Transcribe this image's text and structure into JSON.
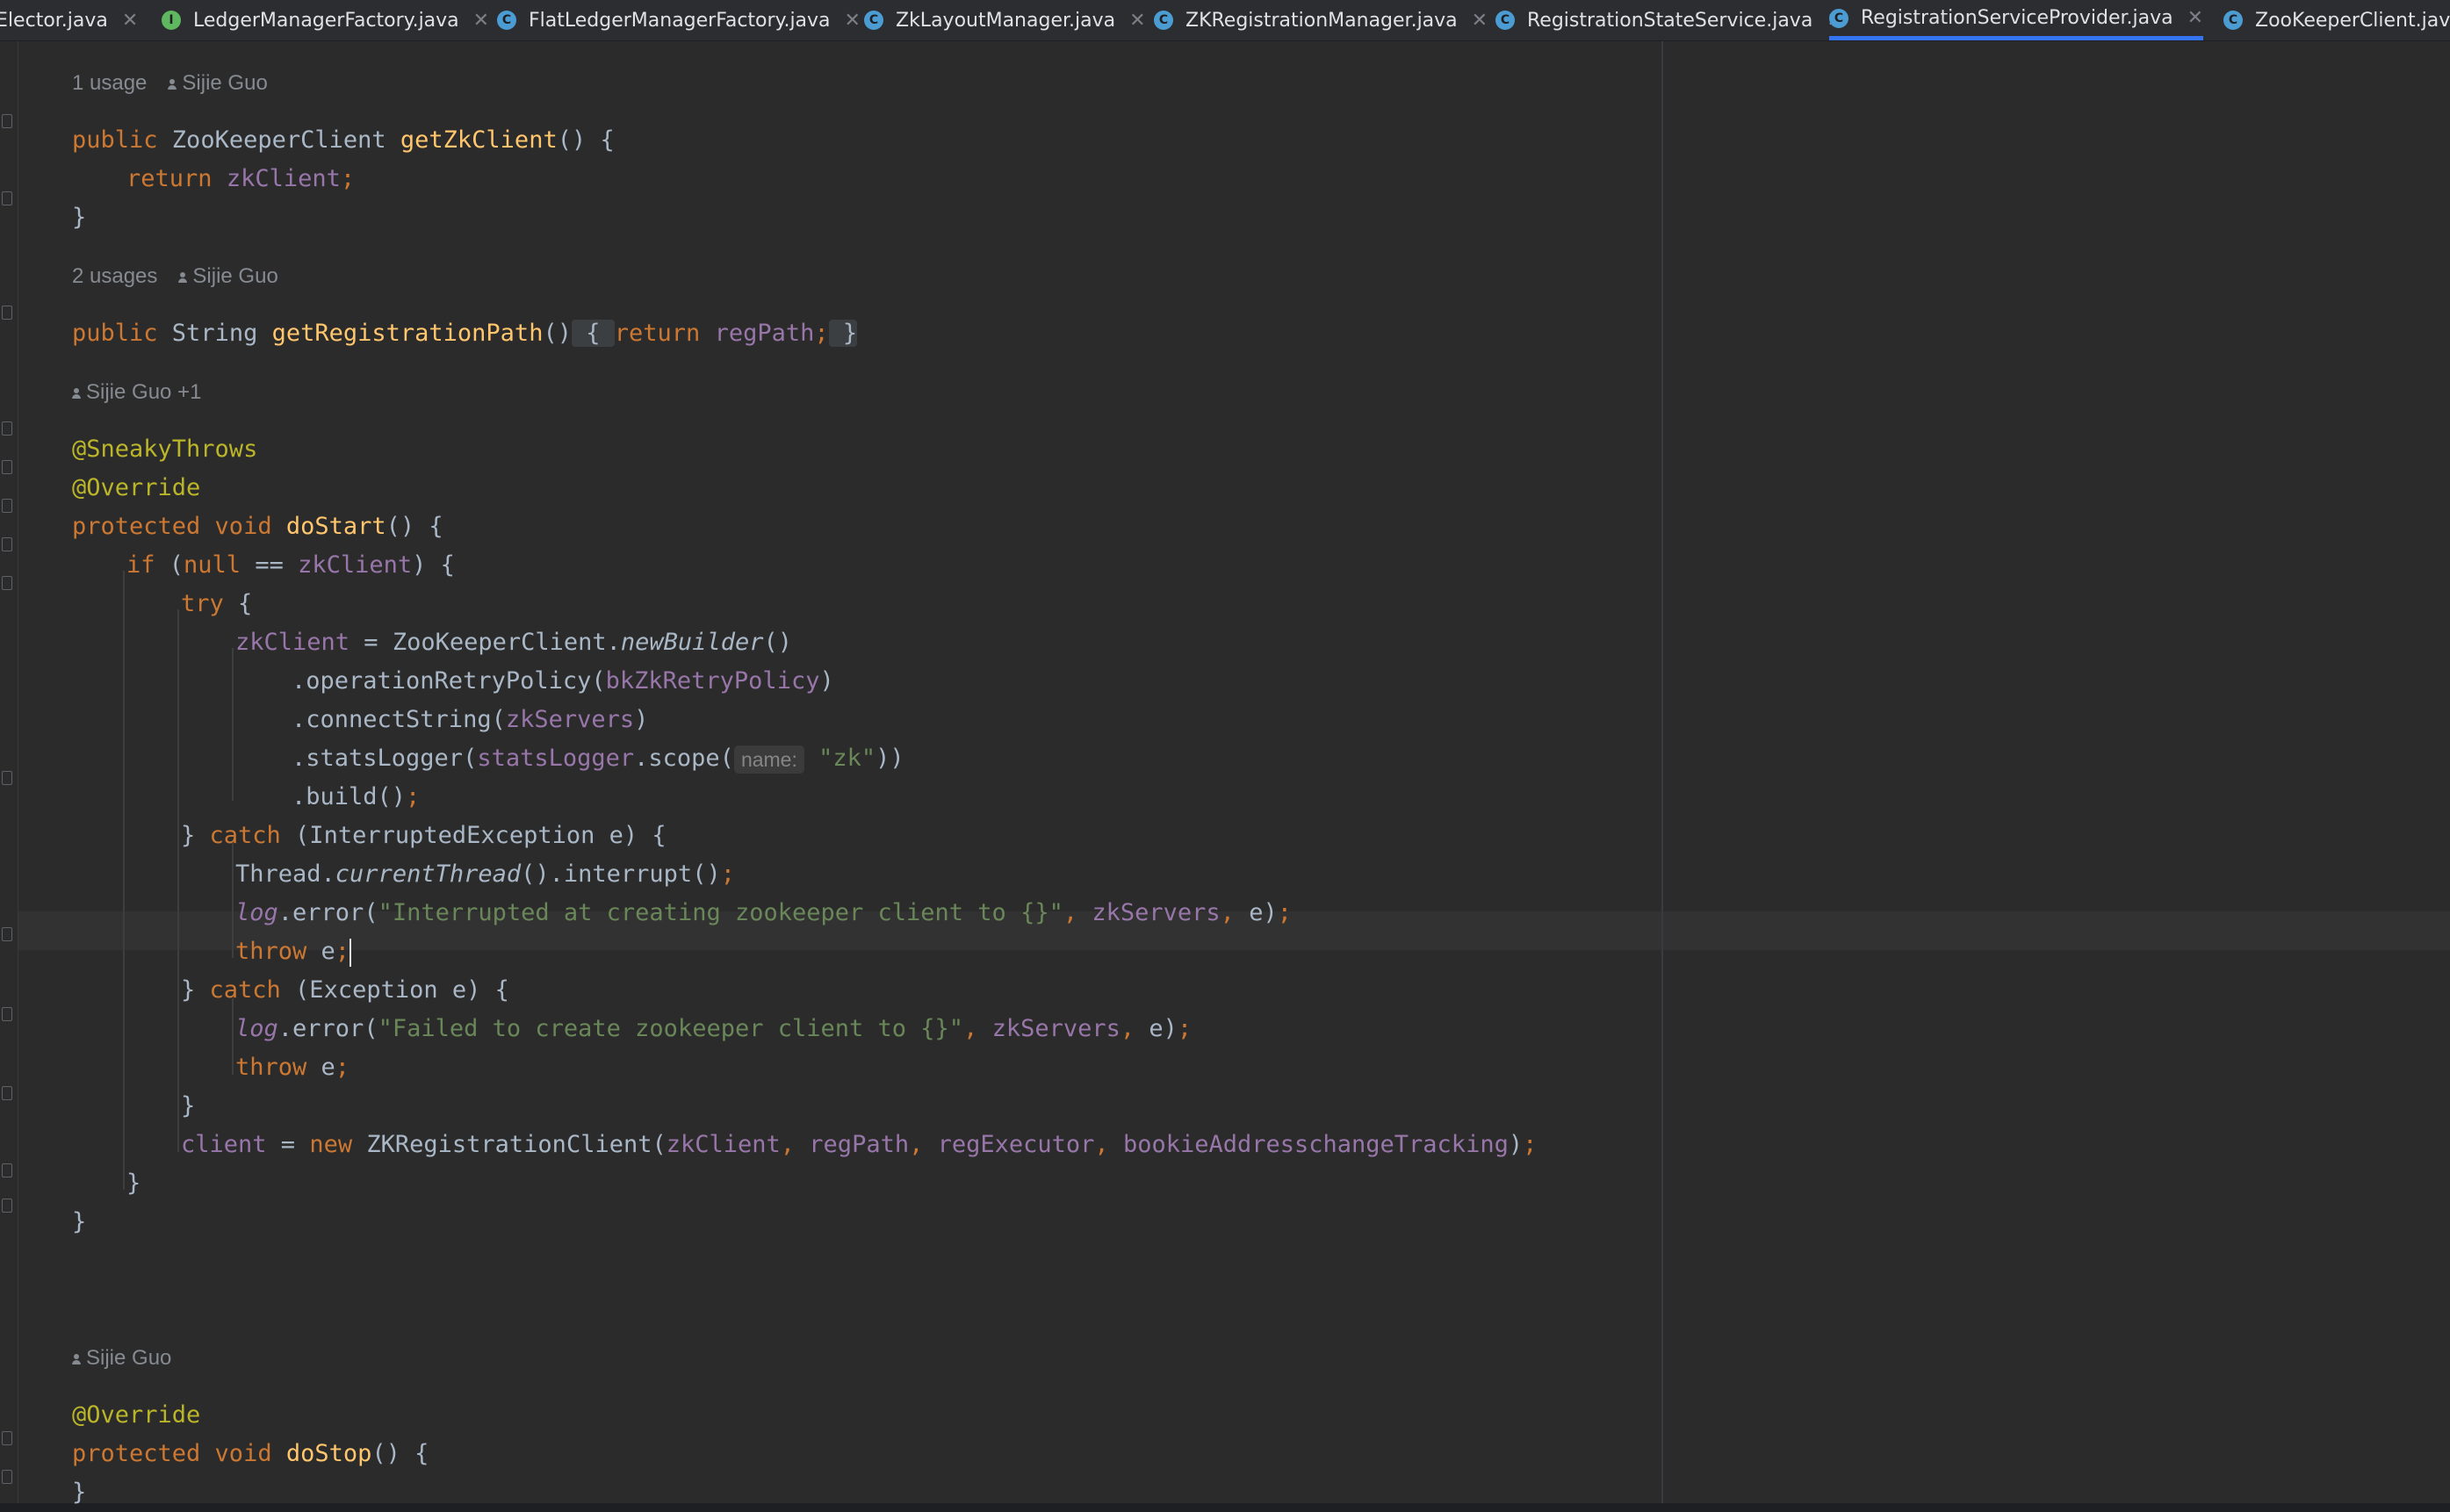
{
  "tabs": [
    {
      "label": "rElector.java",
      "icon": "class-icon",
      "active": false
    },
    {
      "label": "LedgerManagerFactory.java",
      "icon": "interface-icon",
      "active": false
    },
    {
      "label": "FlatLedgerManagerFactory.java",
      "icon": "class-icon",
      "active": false
    },
    {
      "label": "ZkLayoutManager.java",
      "icon": "class-icon",
      "active": false
    },
    {
      "label": "ZKRegistrationManager.java",
      "icon": "class-icon",
      "active": false
    },
    {
      "label": "RegistrationStateService.java",
      "icon": "class-icon",
      "active": false
    },
    {
      "label": "RegistrationServiceProvider.java",
      "icon": "class-icon",
      "active": true
    },
    {
      "label": "ZooKeeperClient.java",
      "icon": "class-icon",
      "active": false
    }
  ],
  "tab_icon_letters": {
    "class": "C",
    "interface": "I"
  },
  "close_glyph": "✕",
  "meta": {
    "m1_usage": "1 usage",
    "m1_author": "Sijie Guo",
    "m2_usage": "2 usages",
    "m2_author": "Sijie Guo",
    "m3_author": "Sijie Guo +1",
    "m4_author": "Sijie Guo"
  },
  "code": {
    "l1": {
      "kw": "public",
      "type": " ZooKeeperClient ",
      "fn": "getZkClient",
      "rest": "() {"
    },
    "l2": {
      "kw": "return",
      "sp": " ",
      "fld": "zkClient",
      "semi": ";"
    },
    "l3": "}",
    "l4": {
      "kw": "public",
      "type": " String ",
      "fn": "getRegistrationPath",
      "rest": "()",
      "fold1": " { ",
      "kw2": "return",
      "sp": " ",
      "fld": "regPath",
      "semi": ";",
      "fold2": " }"
    },
    "l5": "@SneakyThrows",
    "l6": "@Override",
    "l7": {
      "kw": "protected void",
      "sp": " ",
      "fn": "doStart",
      "rest": "() {"
    },
    "l8": {
      "kw": "if",
      "a": " (",
      "kw2": "null",
      "b": " == ",
      "fld": "zkClient",
      "c": ") {"
    },
    "l9": {
      "kw": "try",
      "rest": " {"
    },
    "l10": {
      "fld": "zkClient",
      "a": " = ZooKeeperClient.",
      "ital": "newBuilder",
      "b": "()"
    },
    "l11": {
      "a": ".operationRetryPolicy(",
      "fld": "bkZkRetryPolicy",
      "b": ")"
    },
    "l12": {
      "a": ".connectString(",
      "fld": "zkServers",
      "b": ")"
    },
    "l13": {
      "a": ".statsLogger(",
      "fld": "statsLogger",
      "b": ".scope(",
      "hint": "name:",
      "str": "\"zk\"",
      "c": "))"
    },
    "l14": {
      "a": ".build()",
      "semi": ";"
    },
    "l15": {
      "a": "} ",
      "kw": "catch",
      "b": " (InterruptedException e) {"
    },
    "l16": {
      "a": "Thread.",
      "ital": "currentThread",
      "b": "().interrupt()",
      "semi": ";"
    },
    "l17": {
      "ital": "log",
      "a": ".error(",
      "str": "\"Interrupted at creating zookeeper client to {}\"",
      "c1": ", ",
      "fld": "zkServers",
      "c2": ", ",
      "b": "e)",
      "semi": ";"
    },
    "l18": {
      "kw": "throw",
      "a": " e",
      "semi": ";"
    },
    "l19": {
      "a": "} ",
      "kw": "catch",
      "b": " (Exception e) {"
    },
    "l20": {
      "ital": "log",
      "a": ".error(",
      "str": "\"Failed to create zookeeper client to {}\"",
      "c1": ", ",
      "fld": "zkServers",
      "c2": ", ",
      "b": "e)",
      "semi": ";"
    },
    "l21": {
      "kw": "throw",
      "a": " e",
      "semi": ";"
    },
    "l22": "}",
    "l23": {
      "fld": "client",
      "a": " = ",
      "kw": "new",
      "b": " ZKRegistrationClient(",
      "f1": "zkClient",
      "c1": ", ",
      "f2": "regPath",
      "c2": ", ",
      "f3": "regExecutor",
      "c3": ", ",
      "f4": "bookieAddresschangeTracking",
      "c": ")",
      "semi": ";"
    },
    "l24": "}",
    "l25": "}",
    "l26": "@Override",
    "l27": {
      "kw": "protected void",
      "sp": " ",
      "fn": "doStop",
      "rest": "() {"
    },
    "l28": "}"
  }
}
